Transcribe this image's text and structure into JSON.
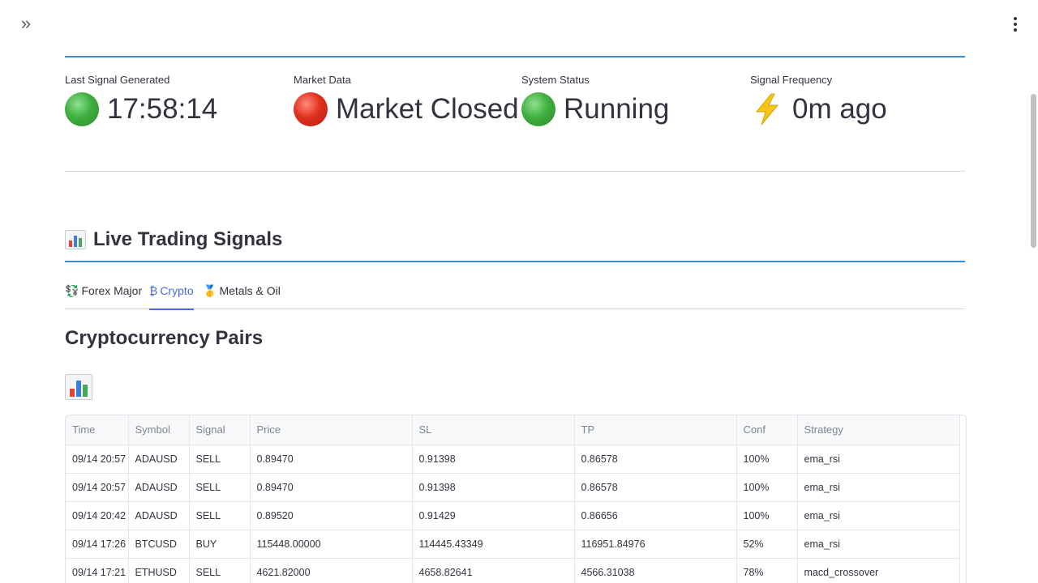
{
  "metrics": [
    {
      "label": "Last Signal Generated",
      "value": "17:58:14",
      "indicator": "green-circle-icon"
    },
    {
      "label": "Market Data",
      "value": "Market Closed",
      "indicator": "red-circle-icon"
    },
    {
      "label": "System Status",
      "value": "Running",
      "indicator": "green-circle-icon"
    },
    {
      "label": "Signal Frequency",
      "value": "0m ago",
      "indicator": "lightning-icon"
    }
  ],
  "signals_section": {
    "title": "Live Trading Signals",
    "icon": "bar-chart-icon"
  },
  "tabs": [
    {
      "label": "Forex Major",
      "icon": "currency-exchange-icon",
      "icon_glyph": "💱",
      "active": false
    },
    {
      "label": "Crypto",
      "icon": "bitcoin-icon",
      "icon_glyph": "₿",
      "active": true
    },
    {
      "label": "Metals & Oil",
      "icon": "medal-icon",
      "icon_glyph": "🥇",
      "active": false
    }
  ],
  "crypto": {
    "title": "Cryptocurrency Pairs",
    "columns": [
      "Time",
      "Symbol",
      "Signal",
      "Price",
      "SL",
      "TP",
      "Conf",
      "Strategy"
    ],
    "rows": [
      [
        "09/14 20:57",
        "ADAUSD",
        "SELL",
        "0.89470",
        "0.91398",
        "0.86578",
        "100%",
        "ema_rsi"
      ],
      [
        "09/14 20:57",
        "ADAUSD",
        "SELL",
        "0.89470",
        "0.91398",
        "0.86578",
        "100%",
        "ema_rsi"
      ],
      [
        "09/14 20:42",
        "ADAUSD",
        "SELL",
        "0.89520",
        "0.91429",
        "0.86656",
        "100%",
        "ema_rsi"
      ],
      [
        "09/14 17:26",
        "BTCUSD",
        "BUY",
        "115448.00000",
        "114445.43349",
        "116951.84976",
        "52%",
        "ema_rsi"
      ],
      [
        "09/14 17:21",
        "ETHUSD",
        "SELL",
        "4621.82000",
        "4658.82641",
        "4566.31038",
        "78%",
        "macd_crossover"
      ]
    ]
  },
  "colors": {
    "accent_blue": "#3a8dd1",
    "tab_active": "#4a6bd8",
    "status_green": "#3fae3f",
    "status_red": "#e0301e"
  }
}
